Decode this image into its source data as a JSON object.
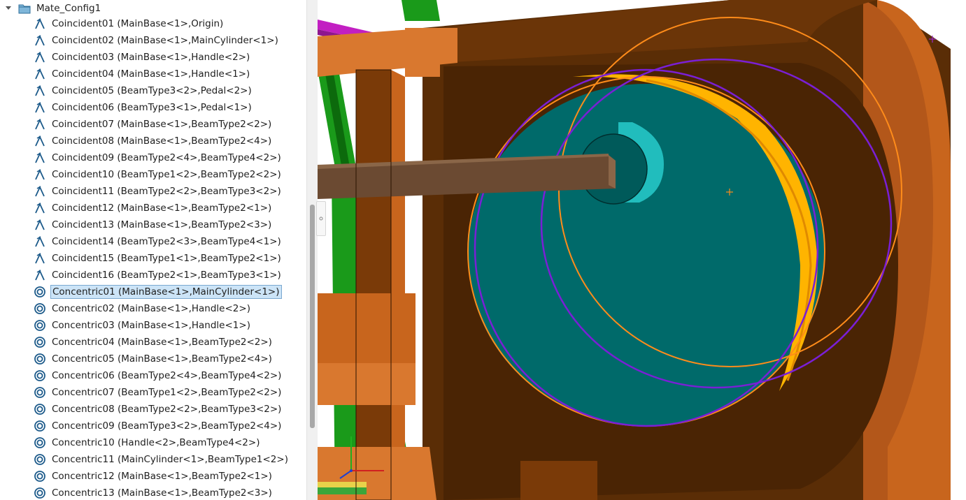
{
  "feature_tree": {
    "folder": {
      "label": "Mate_Config1",
      "expanded": true,
      "icon": "folder-icon"
    },
    "mates": [
      {
        "label": "Coincident01 (MainBase<1>,Origin)",
        "type": "coincident"
      },
      {
        "label": "Coincident02 (MainBase<1>,MainCylinder<1>)",
        "type": "coincident"
      },
      {
        "label": "Coincident03 (MainBase<1>,Handle<2>)",
        "type": "coincident"
      },
      {
        "label": "Coincident04 (MainBase<1>,Handle<1>)",
        "type": "coincident"
      },
      {
        "label": "Coincident05 (BeamType3<2>,Pedal<2>)",
        "type": "coincident"
      },
      {
        "label": "Coincident06 (BeamType3<1>,Pedal<1>)",
        "type": "coincident"
      },
      {
        "label": "Coincident07 (MainBase<1>,BeamType2<2>)",
        "type": "coincident"
      },
      {
        "label": "Coincident08 (MainBase<1>,BeamType2<4>)",
        "type": "coincident"
      },
      {
        "label": "Coincident09 (BeamType2<4>,BeamType4<2>)",
        "type": "coincident"
      },
      {
        "label": "Coincident10 (BeamType1<2>,BeamType2<2>)",
        "type": "coincident"
      },
      {
        "label": "Coincident11 (BeamType2<2>,BeamType3<2>)",
        "type": "coincident"
      },
      {
        "label": "Coincident12 (MainBase<1>,BeamType2<1>)",
        "type": "coincident"
      },
      {
        "label": "Coincident13 (MainBase<1>,BeamType2<3>)",
        "type": "coincident"
      },
      {
        "label": "Coincident14 (BeamType2<3>,BeamType4<1>)",
        "type": "coincident"
      },
      {
        "label": "Coincident15 (BeamType1<1>,BeamType2<1>)",
        "type": "coincident"
      },
      {
        "label": "Coincident16 (BeamType2<1>,BeamType3<1>)",
        "type": "coincident"
      },
      {
        "label": "Concentric01 (MainBase<1>,MainCylinder<1>)",
        "type": "concentric",
        "selected": true
      },
      {
        "label": "Concentric02 (MainBase<1>,Handle<2>)",
        "type": "concentric"
      },
      {
        "label": "Concentric03 (MainBase<1>,Handle<1>)",
        "type": "concentric"
      },
      {
        "label": "Concentric04 (MainBase<1>,BeamType2<2>)",
        "type": "concentric"
      },
      {
        "label": "Concentric05 (MainBase<1>,BeamType2<4>)",
        "type": "concentric"
      },
      {
        "label": "Concentric06 (BeamType2<4>,BeamType4<2>)",
        "type": "concentric"
      },
      {
        "label": "Concentric07 (BeamType1<2>,BeamType2<2>)",
        "type": "concentric"
      },
      {
        "label": "Concentric08 (BeamType2<2>,BeamType3<2>)",
        "type": "concentric"
      },
      {
        "label": "Concentric09 (BeamType3<2>,BeamType2<4>)",
        "type": "concentric"
      },
      {
        "label": "Concentric10 (Handle<2>,BeamType4<2>)",
        "type": "concentric"
      },
      {
        "label": "Concentric11 (MainCylinder<1>,BeamType1<2>)",
        "type": "concentric"
      },
      {
        "label": "Concentric12 (MainBase<1>,BeamType2<1>)",
        "type": "concentric"
      },
      {
        "label": "Concentric13 (MainBase<1>,BeamType2<3>)",
        "type": "concentric"
      }
    ]
  },
  "viewport": {
    "colors": {
      "base_brown": "#5a2d06",
      "frame_orange": "#d9782f",
      "frame_dark": "#7a3a08",
      "cylinder_teal": "#006a6a",
      "hub_cyan": "#21bdbd",
      "rim_yellow": "#ffb400",
      "highlight_orange": "#ff8c1a",
      "highlight_purple": "#7a1fd6",
      "beam_green": "#1a9a1a",
      "handle_brown": "#6b4a32",
      "magenta": "#c21fc2"
    },
    "icons": [
      "origin-marker-icon",
      "triad-axes-icon",
      "center-mark-icon"
    ]
  }
}
